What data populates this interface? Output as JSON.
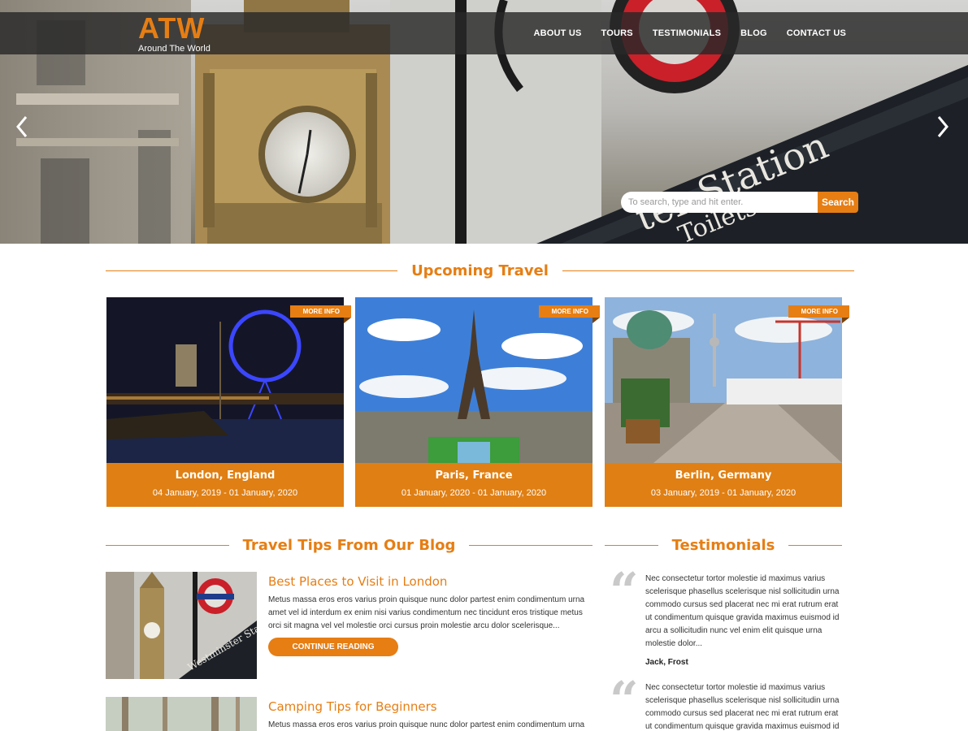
{
  "brand": {
    "logo": "ATW",
    "tagline": "Around The World"
  },
  "nav": {
    "items": [
      "ABOUT US",
      "TOURS",
      "TESTIMONIALS",
      "BLOG",
      "CONTACT US"
    ]
  },
  "hero": {
    "search_placeholder": "To search, type and hit enter.",
    "search_button": "Search",
    "prev_icon": "chevron-left-icon",
    "next_icon": "chevron-right-icon"
  },
  "upcoming": {
    "heading": "Upcoming Travel",
    "cards": [
      {
        "ribbon": "MORE INFO",
        "city": "London, England",
        "dates": "04 January, 2019 - 01 January, 2020"
      },
      {
        "ribbon": "MORE INFO",
        "city": "Paris, France",
        "dates": "01 January, 2020 - 01 January, 2020"
      },
      {
        "ribbon": "MORE INFO",
        "city": "Berlin, Germany",
        "dates": "03 January, 2019 - 01 January, 2020"
      }
    ]
  },
  "blog": {
    "heading": "Travel Tips From Our Blog",
    "posts": [
      {
        "title": "Best Places to Visit in London",
        "excerpt": "Metus massa eros eros varius proin quisque nunc dolor partest enim condimentum urna amet vel id interdum ex enim nisi varius condimentum nec tincidunt eros tristique metus orci sit magna vel vel molestie orci cursus proin molestie arcu dolor scelerisque...",
        "button": "CONTINUE READING"
      },
      {
        "title": "Camping Tips for Beginners",
        "excerpt": "Metus massa eros eros varius proin quisque nunc dolor partest enim condimentum urna"
      }
    ]
  },
  "testimonials": {
    "heading": "Testimonials",
    "quote_icon": "quote-icon",
    "items": [
      {
        "text": "Nec consectetur tortor molestie id maximus varius scelerisque phasellus scelerisque nisl sollicitudin urna commodo cursus sed placerat nec mi erat rutrum erat ut condimentum quisque gravida maximus euismod id arcu a sollicitudin nunc vel enim elit quisque urna molestie dolor...",
        "author": "Jack, Frost"
      },
      {
        "text": "Nec consectetur tortor molestie id maximus varius scelerisque phasellus scelerisque nisl sollicitudin urna commodo cursus sed placerat nec mi erat rutrum erat ut condimentum quisque gravida maximus euismod id"
      }
    ]
  },
  "colors": {
    "accent": "#e67e14",
    "nav_bg": "#282828",
    "card_bg": "#e07f13"
  }
}
